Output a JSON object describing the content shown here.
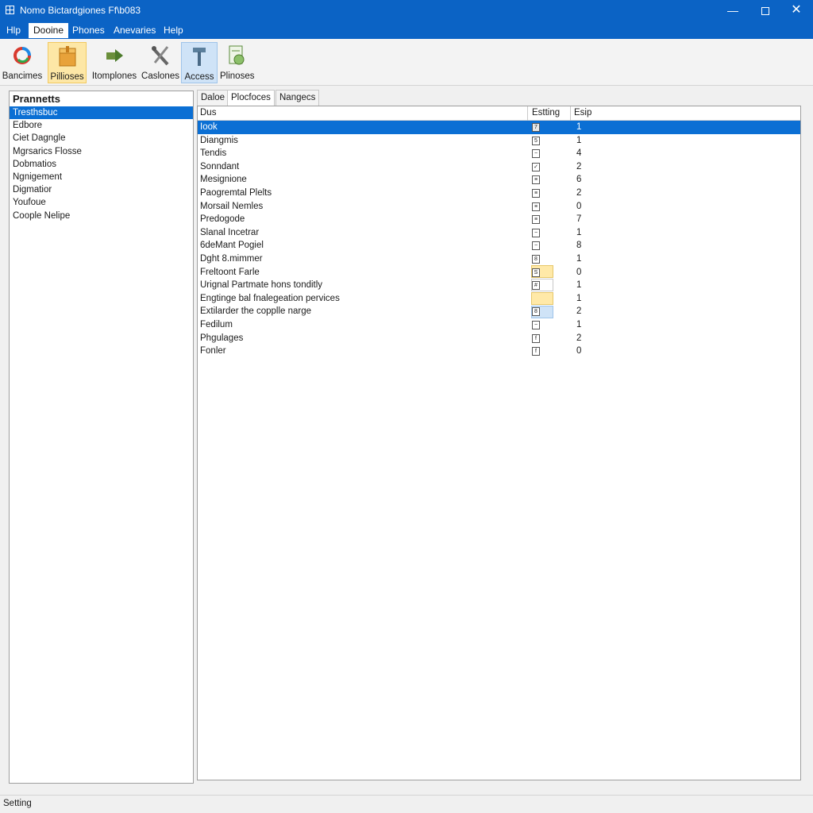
{
  "window": {
    "title": "Nomo Bictardgiones Ff\\b083",
    "minimize_glyph": "—",
    "close_glyph": "✕"
  },
  "menu": [
    "Hlp",
    "Dooine",
    "Phones",
    "Anevaries",
    "Help"
  ],
  "toolbar": [
    {
      "label": "Bancimes",
      "icon": "refresh-icon"
    },
    {
      "label": "Pillioses",
      "icon": "package-icon"
    },
    {
      "label": "Itomplones",
      "icon": "arrow-icon"
    },
    {
      "label": "Caslones",
      "icon": "tools-icon"
    },
    {
      "label": "Access",
      "icon": "hammer-icon"
    },
    {
      "label": "Plinoses",
      "icon": "document-icon"
    }
  ],
  "left_pane": {
    "header": "Prannetts",
    "items": [
      "Tresthsbuc",
      "Edbore",
      "Ciet Dagngle",
      "Mgrsarics Flosse",
      "Dobmatios",
      "Ngnigement",
      "Digmatior",
      "Youfoue",
      "Coople Nelipe"
    ]
  },
  "tabs": [
    "Daloe",
    "Plocfoces",
    "Nangecs"
  ],
  "columns": [
    "Dus",
    "Estting",
    "Esip"
  ],
  "rows": [
    {
      "name": "Iook",
      "icon_glyph": "7",
      "value": "1"
    },
    {
      "name": "Diangmis",
      "icon_glyph": "5",
      "value": "1"
    },
    {
      "name": "Tendis",
      "icon_glyph": "−",
      "value": "4"
    },
    {
      "name": "Sonndant",
      "icon_glyph": "✓",
      "value": "2"
    },
    {
      "name": "Mesignione",
      "icon_glyph": "≡",
      "value": "6"
    },
    {
      "name": "Paogremtal Plelts",
      "icon_glyph": "≡",
      "value": "2"
    },
    {
      "name": "Morsail Nemles",
      "icon_glyph": "≡",
      "value": "0"
    },
    {
      "name": "Predogode",
      "icon_glyph": "≡",
      "value": "7"
    },
    {
      "name": "Slanal Incetrar",
      "icon_glyph": "−",
      "value": "1"
    },
    {
      "name": "6deMant Pogiel",
      "icon_glyph": "−",
      "value": "8"
    },
    {
      "name": "Dght 8.mimmer",
      "icon_glyph": "8",
      "value": "1"
    },
    {
      "name": "Freltoont Farle",
      "icon_glyph": "S",
      "value": "0"
    },
    {
      "name": "Urignal Partmate hons tonditly",
      "icon_glyph": "#",
      "value": "1"
    },
    {
      "name": "Engtinge bal fnalegeation pervices",
      "icon_glyph": "",
      "value": "1"
    },
    {
      "name": "Extilarder the copplle narge",
      "icon_glyph": "8",
      "value": "2"
    },
    {
      "name": "Fedilum",
      "icon_glyph": "−",
      "value": "1"
    },
    {
      "name": "Phgulages",
      "icon_glyph": "f",
      "value": "2"
    },
    {
      "name": "Fonler",
      "icon_glyph": "f",
      "value": "0"
    }
  ],
  "status": "Setting",
  "colors": {
    "titlebar": "#0b63c5",
    "selection": "#0b6fd4",
    "highlight_orange": "#fde7a6",
    "highlight_blue": "#cfe3f7"
  }
}
